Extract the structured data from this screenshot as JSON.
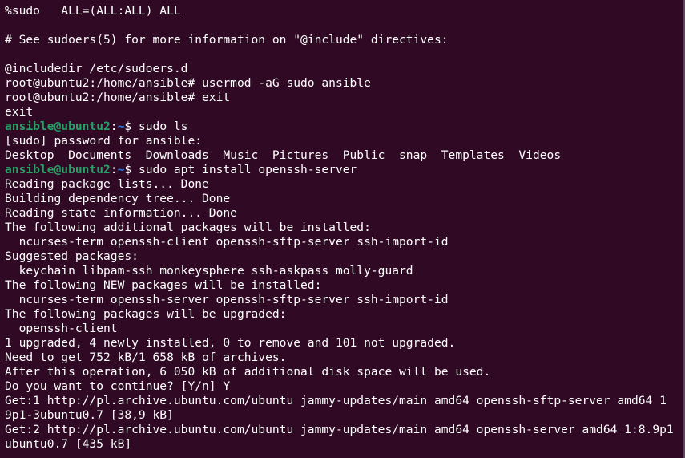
{
  "terminal": {
    "colors": {
      "background": "#300a24",
      "text": "#ffffff",
      "prompt_user": "#26a269",
      "prompt_path": "#2a7bde"
    },
    "lines": [
      {
        "type": "text",
        "text": "%sudo   ALL=(ALL:ALL) ALL"
      },
      {
        "type": "text",
        "text": ""
      },
      {
        "type": "text",
        "text": "# See sudoers(5) for more information on \"@include\" directives:"
      },
      {
        "type": "text",
        "text": ""
      },
      {
        "type": "text",
        "text": "@includedir /etc/sudoers.d"
      },
      {
        "type": "text",
        "text": "root@ubuntu2:/home/ansible# usermod -aG sudo ansible"
      },
      {
        "type": "text",
        "text": "root@ubuntu2:/home/ansible# exit"
      },
      {
        "type": "text",
        "text": "exit"
      },
      {
        "type": "prompt",
        "user": "ansible@ubuntu2",
        "sep": ":",
        "path": "~",
        "sym": "$ ",
        "cmd": "sudo ls"
      },
      {
        "type": "text",
        "text": "[sudo] password for ansible:"
      },
      {
        "type": "text",
        "text": "Desktop  Documents  Downloads  Music  Pictures  Public  snap  Templates  Videos"
      },
      {
        "type": "prompt",
        "user": "ansible@ubuntu2",
        "sep": ":",
        "path": "~",
        "sym": "$ ",
        "cmd": "sudo apt install openssh-server"
      },
      {
        "type": "text",
        "text": "Reading package lists... Done"
      },
      {
        "type": "text",
        "text": "Building dependency tree... Done"
      },
      {
        "type": "text",
        "text": "Reading state information... Done"
      },
      {
        "type": "text",
        "text": "The following additional packages will be installed:"
      },
      {
        "type": "text",
        "text": "  ncurses-term openssh-client openssh-sftp-server ssh-import-id"
      },
      {
        "type": "text",
        "text": "Suggested packages:"
      },
      {
        "type": "text",
        "text": "  keychain libpam-ssh monkeysphere ssh-askpass molly-guard"
      },
      {
        "type": "text",
        "text": "The following NEW packages will be installed:"
      },
      {
        "type": "text",
        "text": "  ncurses-term openssh-server openssh-sftp-server ssh-import-id"
      },
      {
        "type": "text",
        "text": "The following packages will be upgraded:"
      },
      {
        "type": "text",
        "text": "  openssh-client"
      },
      {
        "type": "text",
        "text": "1 upgraded, 4 newly installed, 0 to remove and 101 not upgraded."
      },
      {
        "type": "text",
        "text": "Need to get 752 kB/1 658 kB of archives."
      },
      {
        "type": "text",
        "text": "After this operation, 6 050 kB of additional disk space will be used."
      },
      {
        "type": "text",
        "text": "Do you want to continue? [Y/n] Y"
      },
      {
        "type": "text",
        "text": "Get:1 http://pl.archive.ubuntu.com/ubuntu jammy-updates/main amd64 openssh-sftp-server amd64 1"
      },
      {
        "type": "text",
        "text": "9p1-3ubuntu0.7 [38,9 kB]"
      },
      {
        "type": "text",
        "text": "Get:2 http://pl.archive.ubuntu.com/ubuntu jammy-updates/main amd64 openssh-server amd64 1:8.9p1"
      },
      {
        "type": "text",
        "text": "ubuntu0.7 [435 kB]"
      }
    ]
  }
}
